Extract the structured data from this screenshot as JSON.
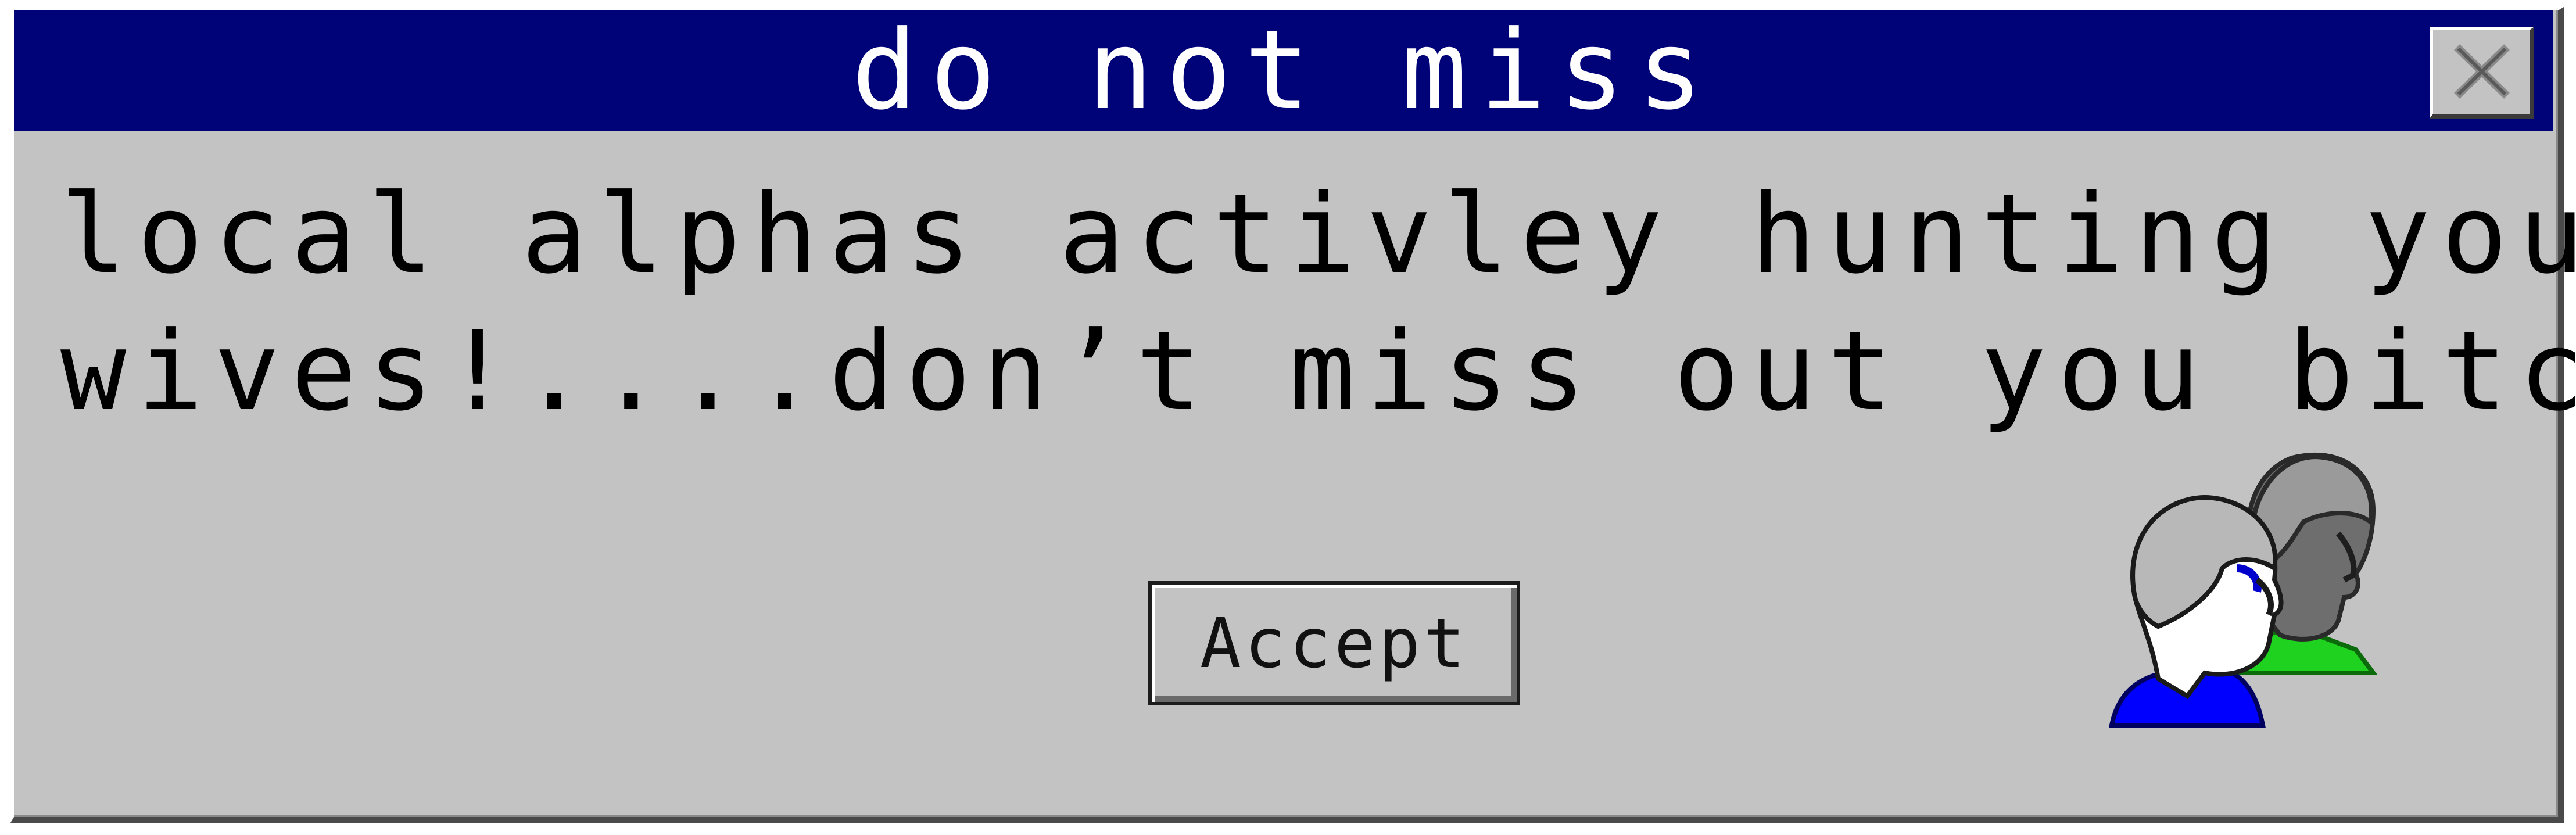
{
  "dialog": {
    "title": "do not miss",
    "message_lines": [
      "local alphas activley hunting your",
      "wives!....don’t miss out you bitch"
    ],
    "accept_label": "Accept"
  },
  "icons": {
    "close": "close-icon",
    "users": "users-icon"
  },
  "colors": {
    "titlebar": "#000278",
    "window": "#c3c3c3",
    "title_text": "#ffffff",
    "front_user_shirt": "#0000ff",
    "back_user_shirt": "#1fd21f"
  }
}
